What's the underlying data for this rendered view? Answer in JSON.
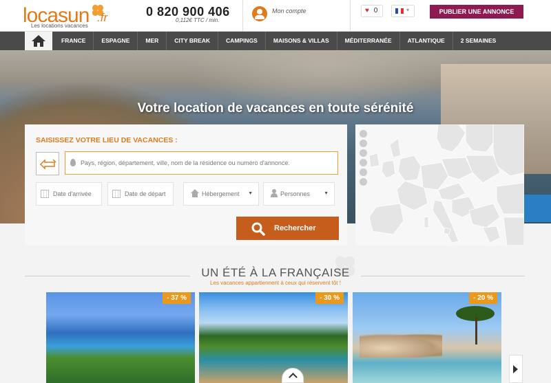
{
  "header": {
    "logo_text": "locasun",
    "logo_tld": ".fr",
    "logo_tagline": "Les locations vacances",
    "phone": "0 820 900 406",
    "phone_price": "0,112€ TTC / min.",
    "account_label": "Mon compte",
    "favorites_count": "0",
    "language": "fr",
    "publish_button": "PUBLIER UNE ANNONCE"
  },
  "nav": {
    "home_icon": "home-icon",
    "items": [
      "FRANCE",
      "ESPAGNE",
      "MER",
      "CITY BREAK",
      "CAMPINGS",
      "MAISONS & VILLAS",
      "MÉDITERRANÉE",
      "ATLANTIQUE",
      "2 SEMAINES"
    ]
  },
  "hero": {
    "title": "Votre location de vacances en toute sérénité"
  },
  "search": {
    "title": "SAISISSEZ VOTRE LIEU DE VACANCES :",
    "destination_placeholder": "Pays, région, département, ville, nom de la résidence ou numéro d'annonce.",
    "arrival_placeholder": "Date d'arrivée",
    "departure_placeholder": "Date de départ",
    "accommodation_label": "Hébergement",
    "persons_label": "Personnes",
    "search_button": "Rechercher"
  },
  "section": {
    "title": "UN ÉTÉ À LA FRANÇAISE",
    "subtitle": "Les vacances appartiennent à ceux qui réservent tôt !"
  },
  "offers": [
    {
      "discount": "- 37 %"
    },
    {
      "discount": "- 30 %"
    },
    {
      "discount": "- 20 %"
    }
  ],
  "colors": {
    "brand_orange": "#e07b1b",
    "publish_purple": "#8e1a52",
    "nav_dark": "#4a4a4a",
    "search_button": "#c75d1c",
    "discount_badge": "#e99a1d"
  }
}
